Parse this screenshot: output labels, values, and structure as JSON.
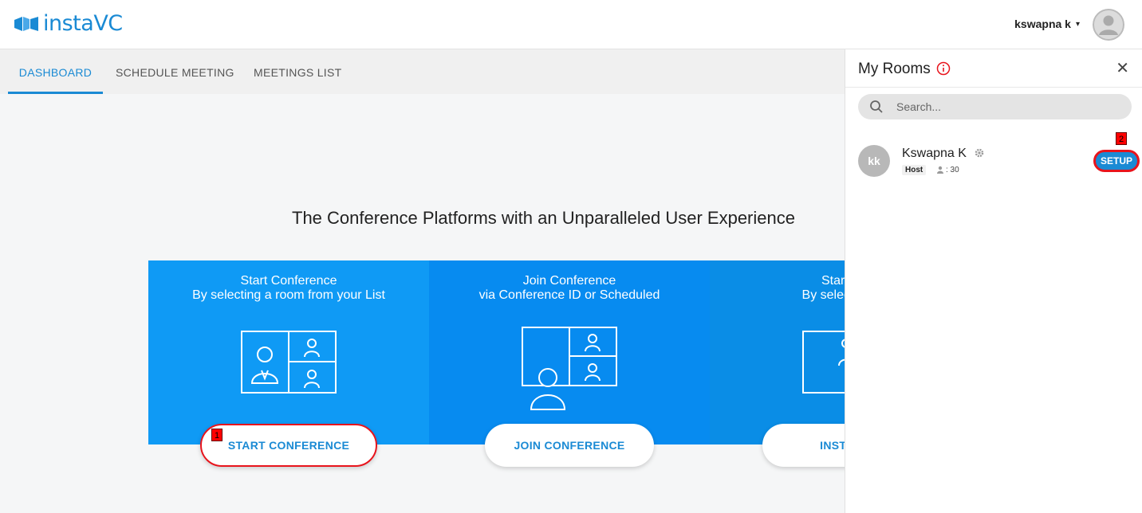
{
  "app": {
    "logo_text": "instaVC",
    "brand_color": "#1a8ad4"
  },
  "header": {
    "username": "kswapna k",
    "caret": "▾"
  },
  "tabs": [
    {
      "label": "DASHBOARD",
      "active": true
    },
    {
      "label": "SCHEDULE MEETING",
      "active": false
    },
    {
      "label": "MEETINGS LIST",
      "active": false
    }
  ],
  "main": {
    "headline": "The Conference Platforms with an Unparalleled User Experience",
    "cards": [
      {
        "title_line1": "Start Conference",
        "title_line2": "By selecting a room from your List",
        "button": "START CONFERENCE"
      },
      {
        "title_line1": "Join Conference",
        "title_line2": "via Conference ID or Scheduled",
        "button": "JOIN CONFERENCE"
      },
      {
        "title_line1": "Start Conf",
        "title_line2": "By selecting a co",
        "button": "INSTA CO"
      }
    ]
  },
  "markers": {
    "m1": "1",
    "m2": "2"
  },
  "panel": {
    "title": "My Rooms",
    "close": "✕",
    "search_placeholder": "Search...",
    "rooms": [
      {
        "initials": "kk",
        "name": "Kswapna K",
        "role": "Host",
        "count": ": 30",
        "action": "SETUP"
      }
    ]
  }
}
